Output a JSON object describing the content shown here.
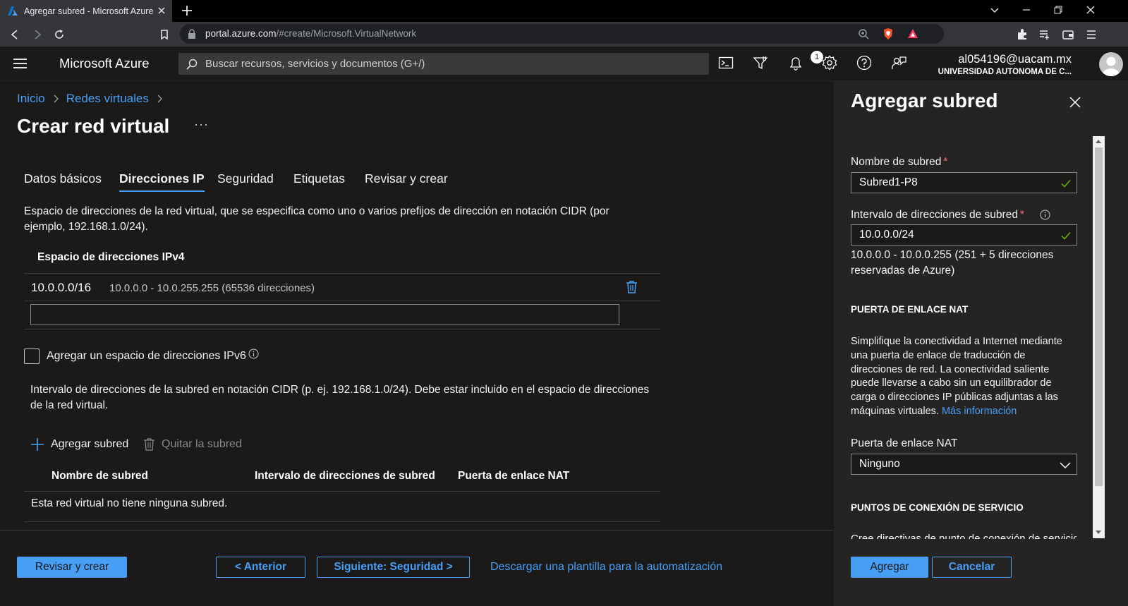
{
  "browser": {
    "tab_title": "Agregar subred - Microsoft Azure",
    "url_host": "portal.azure.com",
    "url_path": "/#create/Microsoft.VirtualNetwork"
  },
  "header": {
    "brand": "Microsoft Azure",
    "search_placeholder": "Buscar recursos, servicios y documentos (G+/)",
    "notification_count": "1",
    "account_email": "al054196@uacam.mx",
    "account_org": "UNIVERSIDAD AUTONOMA DE C..."
  },
  "breadcrumb": {
    "items": [
      "Inicio",
      "Redes virtuales"
    ]
  },
  "page": {
    "title": "Crear red virtual",
    "more": "···",
    "tabs": [
      "Datos básicos",
      "Direcciones IP",
      "Seguridad",
      "Etiquetas",
      "Revisar y crear"
    ],
    "active_tab": "Direcciones IP"
  },
  "ip": {
    "description": "Espacio de direcciones de la red virtual, que se especifica como uno o varios prefijos de dirección en notación CIDR (por ejemplo, 192.168.1.0/24).",
    "ipv4_header": "Espacio de direcciones IPv4",
    "address": "10.0.0.0/16",
    "address_range": "10.0.0.0 - 10.0.255.255 (65536 direcciones)",
    "new_address_value": "",
    "ipv6_label": "Agregar un espacio de direcciones IPv6",
    "subnet_description": "Intervalo de direcciones de la subred en notación CIDR (p. ej. 192.168.1.0/24). Debe estar incluido en el espacio de direcciones de la red virtual.",
    "add_subnet": "Agregar subred",
    "remove_subnet": "Quitar la subred",
    "columns": [
      "Nombre de subred",
      "Intervalo de direcciones de subred",
      "Puerta de enlace NAT"
    ],
    "empty_message": "Esta red virtual no tiene ninguna subred."
  },
  "footer": {
    "review_create": "Revisar y crear",
    "previous": "< Anterior",
    "next": "Siguiente: Seguridad >",
    "download_template": "Descargar una plantilla para la automatización"
  },
  "panel": {
    "title": "Agregar subred",
    "subnet_name_label": "Nombre de subred",
    "subnet_name_value": "Subred1-P8",
    "address_range_label": "Intervalo de direcciones de subred",
    "address_range_value": "10.0.0.0/24",
    "address_range_info": "10.0.0.0 - 10.0.0.255 (251 + 5 direcciones reservadas de Azure)",
    "nat_section": "PUERTA DE ENLACE NAT",
    "nat_description": "Simplifique la conectividad a Internet mediante una puerta de enlace de traducción de direcciones de red. La conectividad saliente puede llevarse a cabo sin un equilibrador de carga o direcciones IP públicas adjuntas a las máquinas virtuales.",
    "nat_link": "Más información",
    "nat_label": "Puerta de enlace NAT",
    "nat_value": "Ninguno",
    "service_section": "PUNTOS DE CONEXIÓN DE SERVICIO",
    "clipped_text": "Cree directivas de punto de conexión de servicio",
    "add_button": "Agregar",
    "cancel_button": "Cancelar"
  },
  "colors": {
    "accent": "#479ef5",
    "background": "#1b1a19",
    "panel": "#252423",
    "required": "#f1707b",
    "valid": "#6bb700"
  }
}
